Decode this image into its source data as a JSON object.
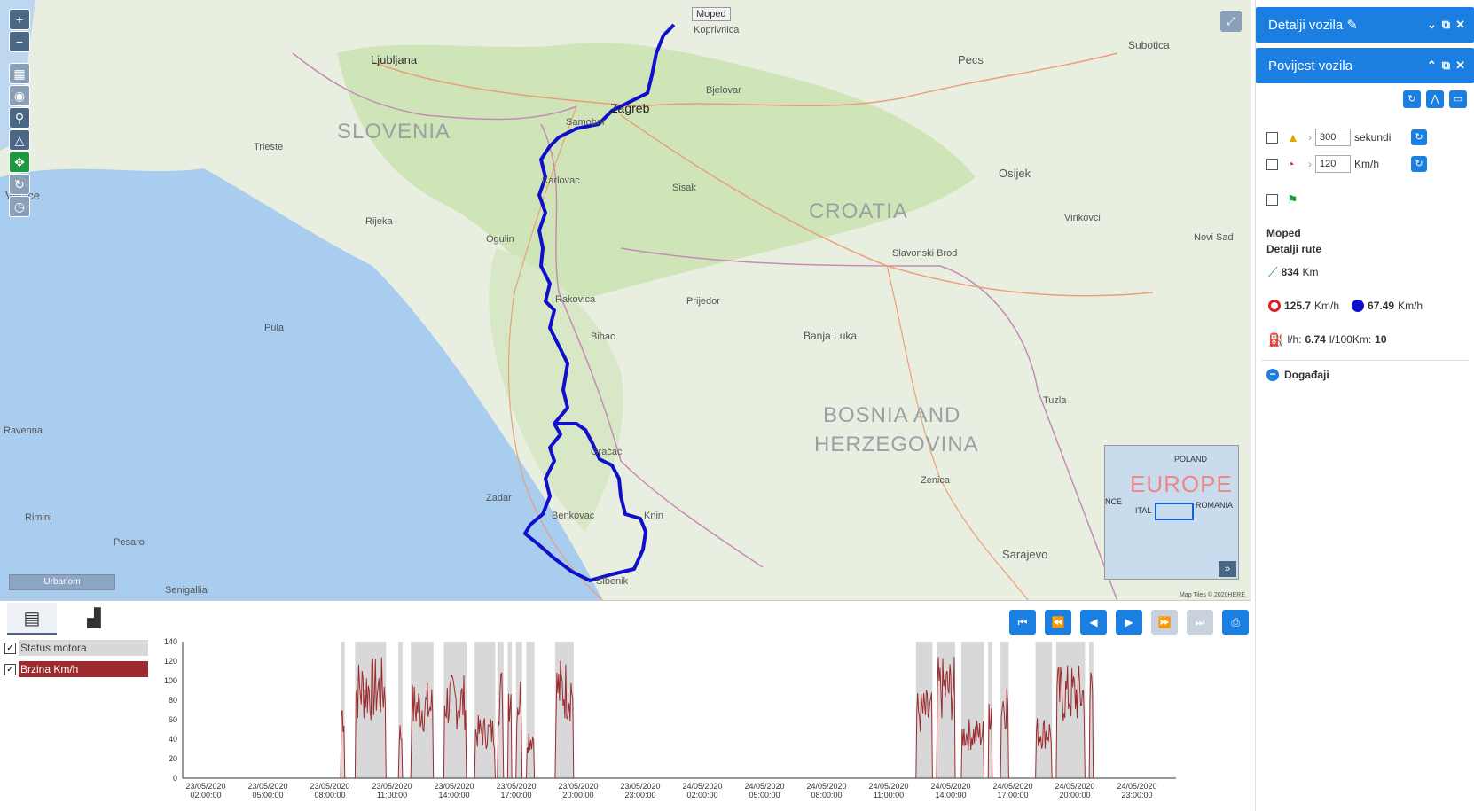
{
  "map": {
    "moped_marker_label": "Moped",
    "scale_label": "Urbanom",
    "attribution": "Map Tiles © 2020HERE",
    "countries": [
      "SLOVENIA",
      "CROATIA",
      "BOSNIA AND",
      "HERZEGOVINA"
    ],
    "cities": [
      "Ljubljana",
      "Zagreb",
      "Samobor",
      "Karlovac",
      "Rijeka",
      "Trieste",
      "Sisak",
      "Bihac",
      "Zadar",
      "Benkovac",
      "Knin",
      "Sibenik",
      "Gračac",
      "Rakovica",
      "Ogulin",
      "Osijek",
      "Pecs",
      "Subotica",
      "Koprivnica",
      "Bjelovar",
      "Banja Luka",
      "Sarajevo",
      "Zenica",
      "Tuzla",
      "Prijedor",
      "Pula",
      "Slavonski Brod",
      "Vinkovci",
      "Novi Sad",
      "Senigallia",
      "Rimini",
      "Pesaro",
      "Ravenna",
      "Venice"
    ],
    "minimap": {
      "title": "EUROPE",
      "labels": [
        "POLAND",
        "ROMANIA",
        "ITAL",
        "NCE"
      ]
    },
    "tools": [
      "zoom-in",
      "zoom-out",
      "layers",
      "streetview",
      "search",
      "measure",
      "locate",
      "refresh",
      "history"
    ]
  },
  "tabs": {
    "table_icon": "table-view",
    "chart_icon": "chart-view"
  },
  "player_buttons": [
    "first",
    "prev-fast",
    "prev",
    "next",
    "next-fast",
    "last",
    "print"
  ],
  "legend": [
    {
      "label": "Status motora",
      "checked": true,
      "color": "#d8d8d8"
    },
    {
      "label": "Brzina Km/h",
      "checked": true,
      "color": "#9b2b2f"
    }
  ],
  "chart_data": {
    "type": "bar",
    "ylim": [
      0,
      140
    ],
    "y_ticks": [
      0,
      20,
      40,
      60,
      80,
      100,
      120,
      140
    ],
    "x_tick_dates": [
      "23/05/2020",
      "23/05/2020",
      "23/05/2020",
      "23/05/2020",
      "23/05/2020",
      "23/05/2020",
      "23/05/2020",
      "23/05/2020",
      "24/05/2020",
      "24/05/2020",
      "24/05/2020",
      "24/05/2020",
      "24/05/2020",
      "24/05/2020",
      "24/05/2020",
      "24/05/2020"
    ],
    "x_tick_times": [
      "02:00:00",
      "05:00:00",
      "08:00:00",
      "11:00:00",
      "14:00:00",
      "17:00:00",
      "20:00:00",
      "23:00:00",
      "02:00:00",
      "05:00:00",
      "08:00:00",
      "11:00:00",
      "14:00:00",
      "17:00:00",
      "20:00:00",
      "23:00:00"
    ],
    "x_range_hours": [
      0,
      48
    ],
    "series": [
      {
        "name": "Status motora",
        "engine_on_hours": [
          [
            6.8,
            7.0
          ],
          [
            7.5,
            9.0
          ],
          [
            9.6,
            9.8
          ],
          [
            10.2,
            11.3
          ],
          [
            11.8,
            12.9
          ],
          [
            13.3,
            14.3
          ],
          [
            14.4,
            14.7
          ],
          [
            14.9,
            15.1
          ],
          [
            15.3,
            15.6
          ],
          [
            15.8,
            16.2
          ],
          [
            17.2,
            18.1
          ],
          [
            34.7,
            35.5
          ],
          [
            35.7,
            36.6
          ],
          [
            36.9,
            38.0
          ],
          [
            38.2,
            38.4
          ],
          [
            38.8,
            39.2
          ],
          [
            40.5,
            41.3
          ],
          [
            41.5,
            42.9
          ],
          [
            43.1,
            43.3
          ]
        ]
      },
      {
        "name": "Brzina Km/h",
        "peak_km_h": [
          92,
          125,
          62,
          100,
          108,
          65,
          118,
          120,
          112,
          58,
          125
        ]
      }
    ]
  },
  "sidebar": {
    "panel1_title": "Detalji vozila",
    "panel2_title": "Povijest vozila",
    "filter_stop": {
      "value": "300",
      "unit": "sekundi"
    },
    "filter_speed": {
      "value": "120",
      "unit": "Km/h"
    },
    "vehicle": "Moped",
    "route_title": "Detalji rute",
    "distance": "834",
    "distance_unit": "Km",
    "max_speed": "125.7",
    "avg_speed": "67.49",
    "speed_unit": "Km/h",
    "fuel_lh_label": "l/h:",
    "fuel_lh": "6.74",
    "fuel_100_label": "l/100Km:",
    "fuel_100": "10",
    "events_label": "Događaji"
  },
  "colors": {
    "accent": "#1a7fe0",
    "route": "#1010cc",
    "speed": "#9b2b2f",
    "engine": "#d8d8d8"
  }
}
